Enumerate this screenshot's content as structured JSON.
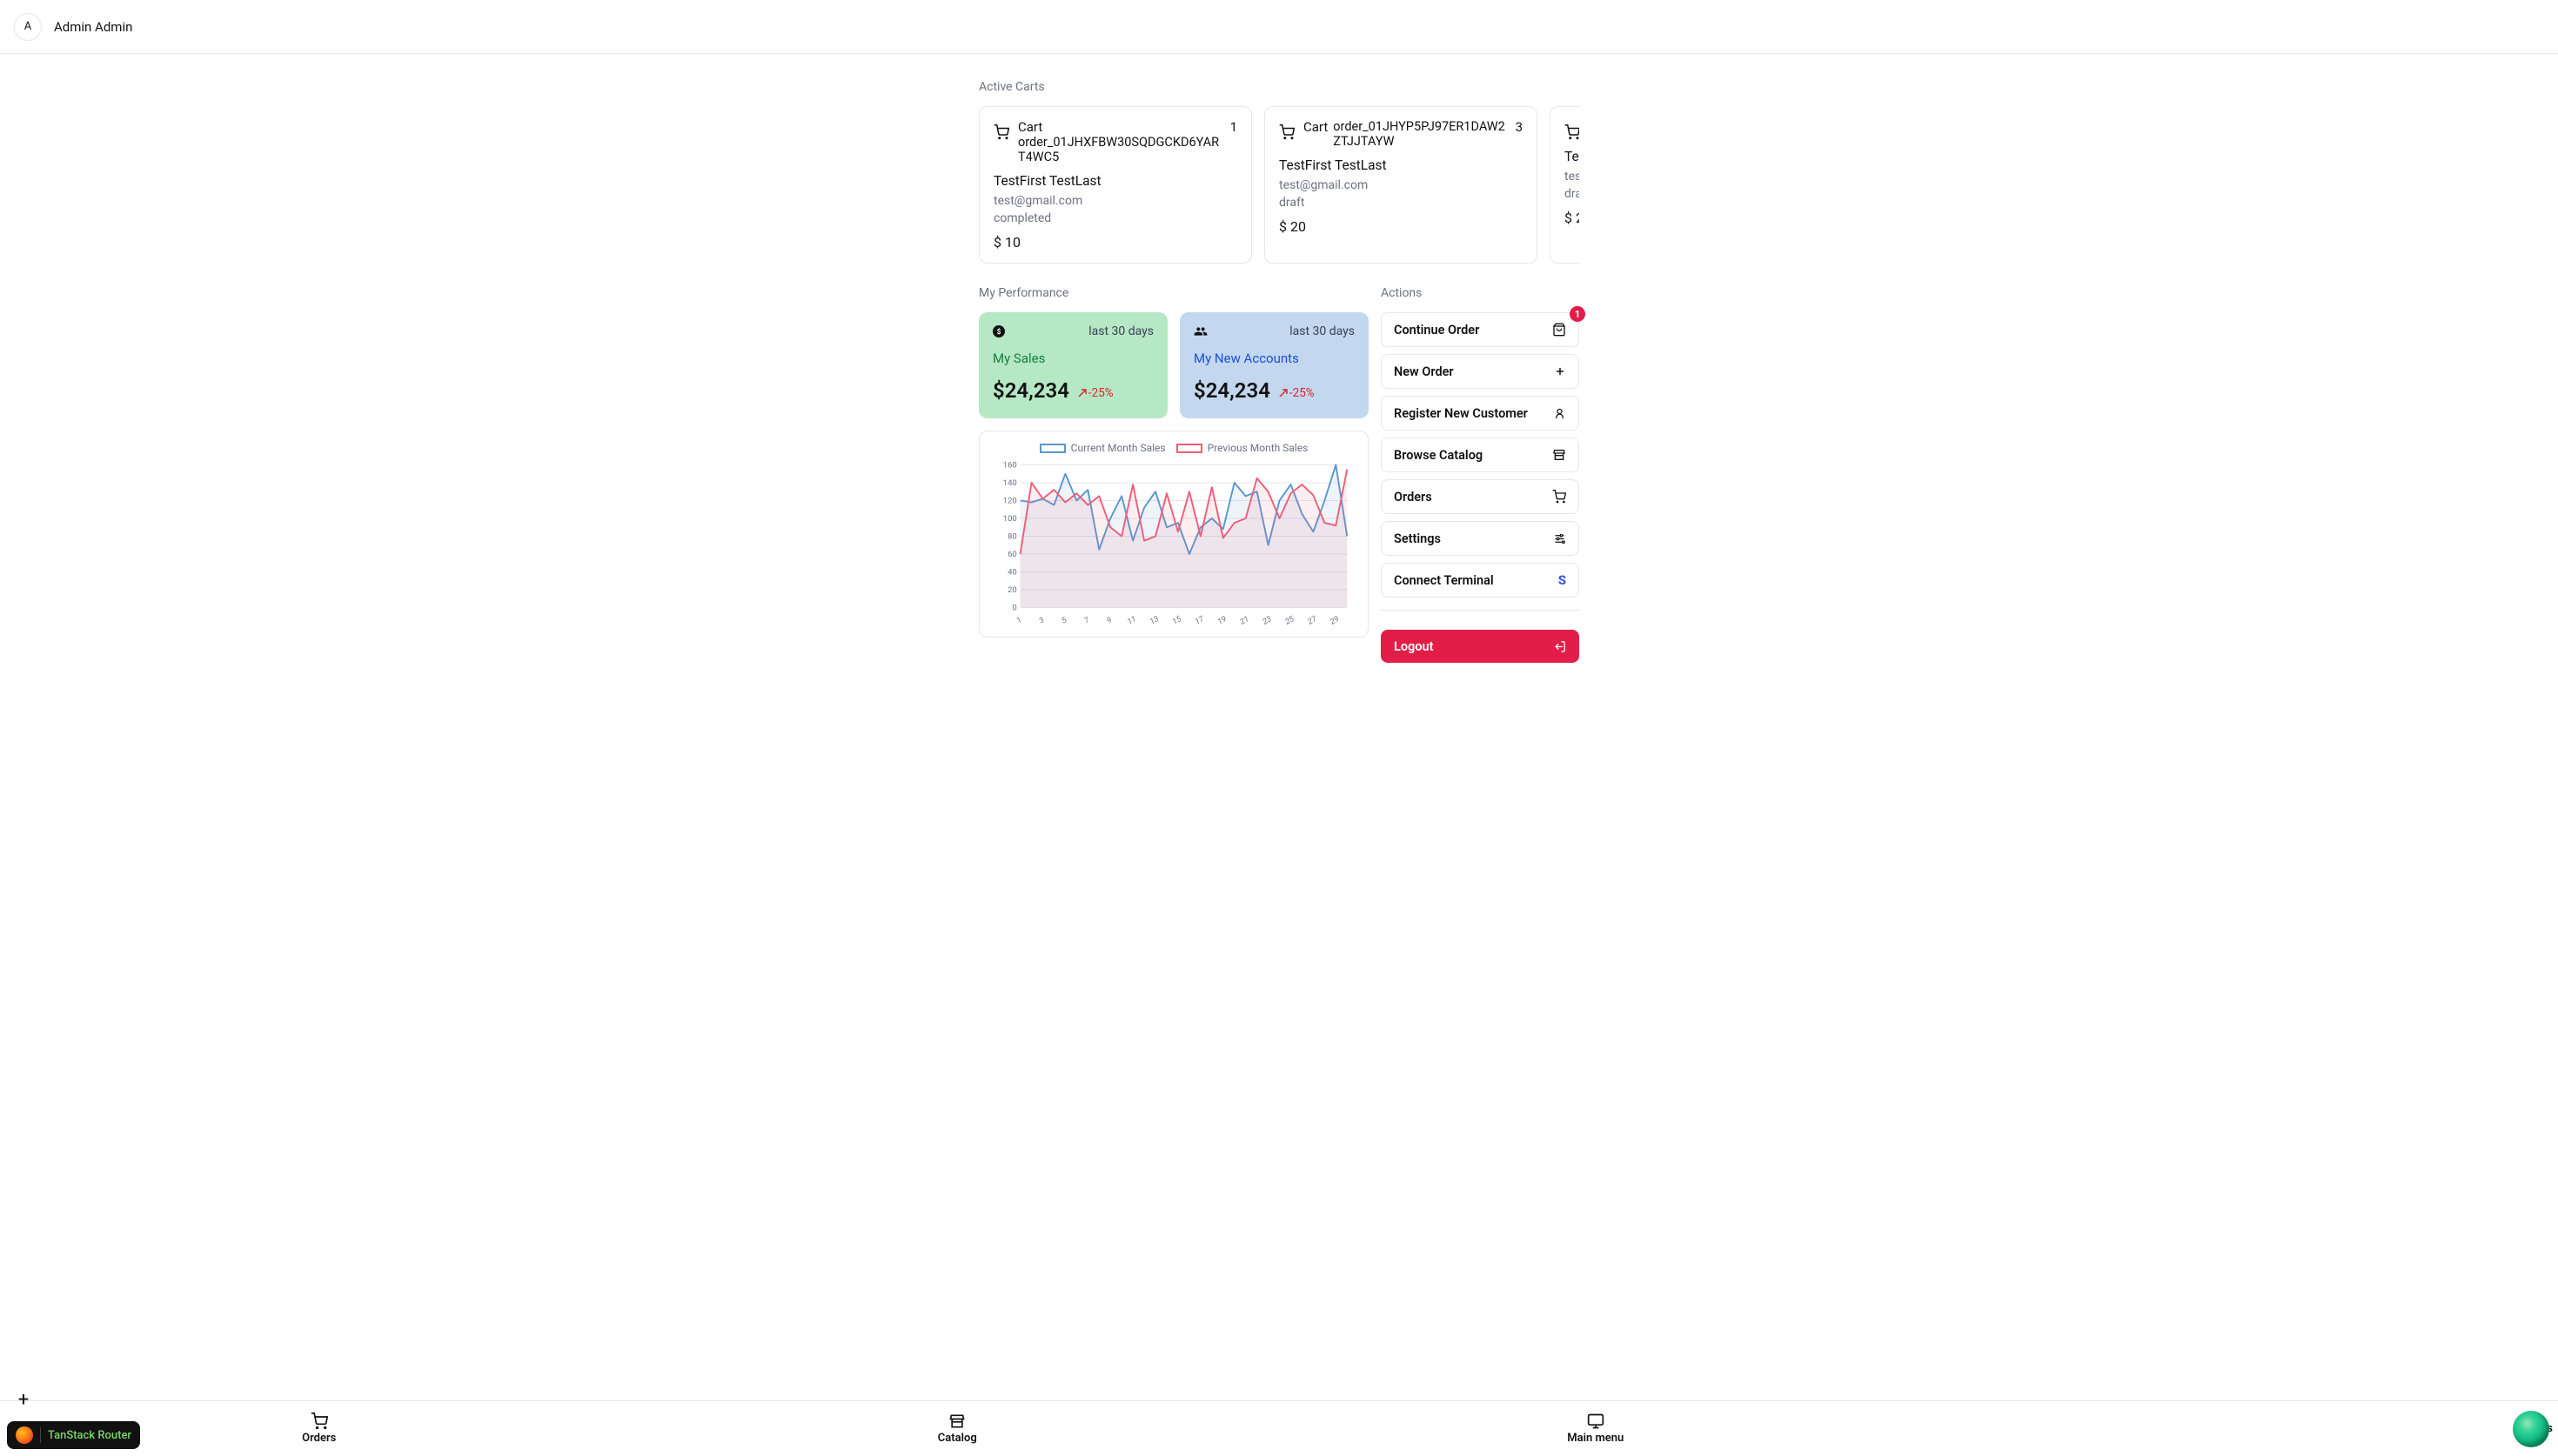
{
  "header": {
    "avatar_initial": "A",
    "username": "Admin Admin"
  },
  "sections": {
    "active_carts_title": "Active Carts",
    "my_performance_title": "My Performance",
    "actions_title": "Actions"
  },
  "carts": [
    {
      "label_line1": "Cart",
      "id": "order_01JHXFBW30SQDGCKD6YART4WC5",
      "count": "1",
      "customer_name": "TestFirst TestLast",
      "customer_email": "test@gmail.com",
      "status": "completed",
      "amount": "$ 10"
    },
    {
      "label_line1": "Cart",
      "id": "order_01JHYP5PJ97ER1DAW2ZTJJTAYW",
      "count": "3",
      "customer_name": "TestFirst TestLast",
      "customer_email": "test@gmail.com",
      "status": "draft",
      "amount": "$ 20"
    },
    {
      "label_line1": "",
      "id": "",
      "count": "",
      "customer_name": "Te",
      "customer_email": "tes",
      "status": "dra",
      "amount": "$ 2"
    }
  ],
  "metrics": {
    "sales": {
      "title": "My Sales",
      "period": "last 30 days",
      "value": "$24,234",
      "delta": "-25%"
    },
    "accounts": {
      "title": "My New Accounts",
      "period": "last 30 days",
      "value": "$24,234",
      "delta": "-25%"
    }
  },
  "actions": {
    "continue_order": "Continue Order",
    "continue_badge": "1",
    "new_order": "New Order",
    "register_customer": "Register New Customer",
    "browse_catalog": "Browse Catalog",
    "orders": "Orders",
    "settings": "Settings",
    "connect_terminal": "Connect Terminal",
    "logout": "Logout"
  },
  "bottom_nav": {
    "orders": "Orders",
    "catalog": "Catalog",
    "main_menu": "Main menu",
    "customers_partial": "Cus"
  },
  "router_pill": "TanStack Router",
  "chart_data": {
    "type": "line",
    "title": "",
    "xlabel": "",
    "ylabel": "",
    "ylim": [
      0,
      160
    ],
    "y_ticks": [
      0,
      20,
      40,
      60,
      80,
      100,
      120,
      140,
      160
    ],
    "x_ticks": [
      1,
      3,
      5,
      7,
      9,
      11,
      13,
      15,
      17,
      19,
      21,
      23,
      25,
      27,
      29
    ],
    "x": [
      1,
      2,
      3,
      4,
      5,
      6,
      7,
      8,
      9,
      10,
      11,
      12,
      13,
      14,
      15,
      16,
      17,
      18,
      19,
      20,
      21,
      22,
      23,
      24,
      25,
      26,
      27,
      28,
      29,
      30
    ],
    "series": [
      {
        "name": "Current Month Sales",
        "color": "#5a97d1",
        "values": [
          120,
          118,
          122,
          115,
          150,
          120,
          132,
          65,
          100,
          125,
          75,
          112,
          130,
          90,
          95,
          60,
          90,
          100,
          88,
          140,
          125,
          130,
          70,
          120,
          138,
          105,
          85,
          120,
          160,
          80
        ]
      },
      {
        "name": "Previous Month Sales",
        "color": "#ef5d78",
        "values": [
          60,
          140,
          122,
          132,
          118,
          128,
          115,
          125,
          90,
          80,
          138,
          75,
          80,
          128,
          85,
          130,
          80,
          135,
          78,
          95,
          100,
          145,
          130,
          100,
          128,
          138,
          126,
          95,
          92,
          155
        ]
      }
    ],
    "legend_labels": {
      "current": "Current Month Sales",
      "previous": "Previous Month Sales"
    }
  }
}
